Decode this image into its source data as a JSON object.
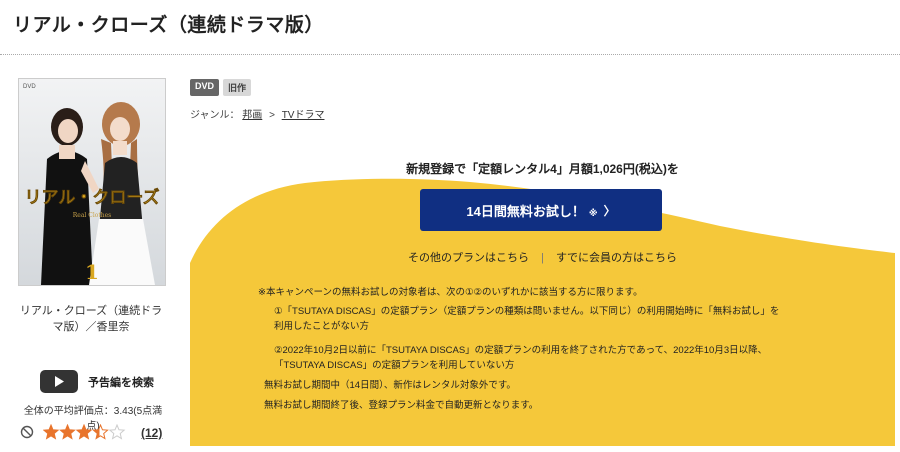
{
  "page": {
    "title": "リアル・クローズ（連続ドラマ版）"
  },
  "sidebar": {
    "cover_alt": "リアル・クローズ",
    "cover_title_text": "リアル・クローズ",
    "cover_subtitle": "Real Clothes",
    "cover_volume": "1",
    "cover_label": "DVD",
    "caption": "リアル・クローズ（連続ドラマ版）／香里奈",
    "trailer_label": "予告編を検索",
    "rating_text": "全体の平均評価点：3.43(5点満点)",
    "rating_value": 3.43,
    "rating_max": 5,
    "review_count": "(12)"
  },
  "badges": [
    "DVD",
    "旧作"
  ],
  "genre": {
    "prefix": "ジャンル：",
    "crumbs": [
      "邦画",
      "TVドラマ"
    ],
    "separator": ">"
  },
  "promo": {
    "headline": "新規登録で「定額レンタル4」月額1,026円(税込)を",
    "cta_label": "14日間無料お試し！",
    "cta_mark": "※",
    "cta_arrow": "〉",
    "other_plans": "その他のプランはこちら",
    "link_separator": "|",
    "members_link": "すでに会員の方はこちら",
    "notes": [
      "※本キャンペーンの無料お試しの対象者は、次の①②のいずれかに該当する方に限ります。",
      "①「TSUTAYA DISCAS」の定額プラン（定額プランの種類は問いません。以下同じ）の利用開始時に「無料お試し」を",
      "利用したことがない方",
      "②2022年10月2日以前に「TSUTAYA DISCAS」の定額プランの利用を終了された方であって、2022年10月3日以降、",
      "「TSUTAYA DISCAS」の定額プランを利用していない方",
      "無料お試し期間中（14日間）、新作はレンタル対象外です。",
      "無料お試し期間終了後、登録プラン料金で自動更新となります。"
    ]
  },
  "colors": {
    "promo_yellow": "#f5c83a",
    "cta_blue": "#102f82",
    "star_filled": "#e8742c",
    "star_empty": "#cccccc"
  }
}
